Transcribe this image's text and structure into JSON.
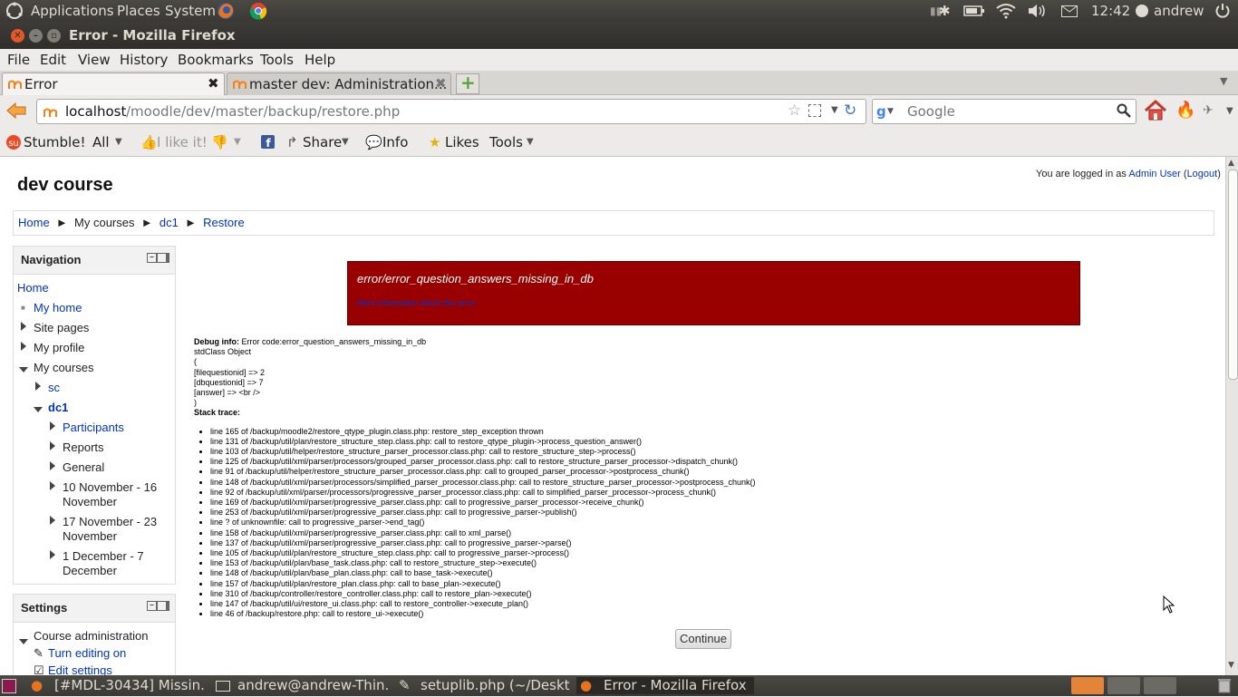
{
  "top_panel": {
    "menus": [
      "Applications",
      "Places",
      "System"
    ],
    "clock": "12:42",
    "user": "andrew"
  },
  "window": {
    "title": "Error - Mozilla Firefox"
  },
  "menubar": [
    "File",
    "Edit",
    "View",
    "History",
    "Bookmarks",
    "Tools",
    "Help"
  ],
  "tabs": [
    {
      "label": "Error",
      "active": true
    },
    {
      "label": "master dev: Administration...",
      "active": false
    }
  ],
  "navbar": {
    "url_host": "localhost",
    "url_path": "/moodle/dev/master/backup/restore.php",
    "search_placeholder": "Google"
  },
  "stumble_toolbar": {
    "stumble": "Stumble!",
    "all": "All",
    "like": "I like it!",
    "share": "Share",
    "info": "Info",
    "likes": "Likes",
    "tools": "Tools"
  },
  "page": {
    "heading": "dev course",
    "login_prefix": "You are logged in as",
    "login_user": "Admin User",
    "logout": "Logout",
    "breadcrumb": [
      "Home",
      "My courses",
      "dc1",
      "Restore"
    ],
    "navigation": {
      "title": "Navigation",
      "items": {
        "home": "Home",
        "my_home": "My home",
        "site_pages": "Site pages",
        "my_profile": "My profile",
        "my_courses": "My courses",
        "sc": "sc",
        "dc1": "dc1",
        "participants": "Participants",
        "reports": "Reports",
        "general": "General",
        "week1": "10 November - 16 November",
        "week2": "17 November - 23 November",
        "week3": "1 December - 7 December"
      }
    },
    "settings": {
      "title": "Settings",
      "course_admin": "Course administration",
      "turn_editing": "Turn editing on",
      "edit_settings": "Edit settings"
    },
    "error": {
      "message": "error/error_question_answers_missing_in_db",
      "more_info": "More information about this error"
    },
    "debug": {
      "label": "Debug info:",
      "code": "Error code:error_question_answers_missing_in_db",
      "lines": [
        "stdClass Object",
        "(",
        "[filequestionid] => 2",
        "[dbquestionid] => 7",
        "[answer] => <br />",
        ")"
      ],
      "stack_label": "Stack trace:",
      "trace": [
        "line 165 of /backup/moodle2/restore_qtype_plugin.class.php: restore_step_exception thrown",
        "line 131 of /backup/util/plan/restore_structure_step.class.php: call to restore_qtype_plugin->process_question_answer()",
        "line 103 of /backup/util/helper/restore_structure_parser_processor.class.php: call to restore_structure_step->process()",
        "line 125 of /backup/util/xml/parser/processors/grouped_parser_processor.class.php: call to restore_structure_parser_processor->dispatch_chunk()",
        "line 91 of /backup/util/helper/restore_structure_parser_processor.class.php: call to grouped_parser_processor->postprocess_chunk()",
        "line 148 of /backup/util/xml/parser/processors/simplified_parser_processor.class.php: call to restore_structure_parser_processor->postprocess_chunk()",
        "line 92 of /backup/util/xml/parser/processors/progressive_parser_processor.class.php: call to simplified_parser_processor->process_chunk()",
        "line 169 of /backup/util/xml/parser/progressive_parser.class.php: call to progressive_parser_processor->receive_chunk()",
        "line 253 of /backup/util/xml/parser/progressive_parser.class.php: call to progressive_parser->publish()",
        "line ? of unknownfile: call to progressive_parser->end_tag()",
        "line 158 of /backup/util/xml/parser/progressive_parser.class.php: call to xml_parse()",
        "line 137 of /backup/util/xml/parser/progressive_parser.class.php: call to progressive_parser->parse()",
        "line 105 of /backup/util/plan/restore_structure_step.class.php: call to progressive_parser->process()",
        "line 153 of /backup/util/plan/base_task.class.php: call to restore_structure_step->execute()",
        "line 148 of /backup/util/plan/base_plan.class.php: call to base_task->execute()",
        "line 157 of /backup/util/plan/restore_plan.class.php: call to base_plan->execute()",
        "line 310 of /backup/controller/restore_controller.class.php: call to restore_plan->execute()",
        "line 147 of /backup/util/ui/restore_ui.class.php: call to restore_controller->execute_plan()",
        "line 46 of /backup/restore.php: call to restore_ui->execute()"
      ]
    },
    "continue_label": "Continue"
  },
  "taskbar": [
    "[#MDL-30434] Missin...",
    "andrew@andrew-Thin...",
    "setuplib.php (~/Deskt...",
    "Error - Mozilla Firefox"
  ],
  "colors": {
    "error_bg": "#990000",
    "link": "#0033cc"
  }
}
